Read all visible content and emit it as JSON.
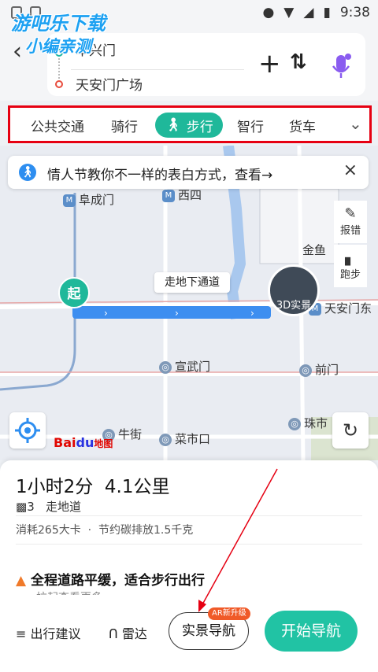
{
  "watermark": {
    "line1": "游吧乐下载",
    "line2": "小编亲测"
  },
  "status_bar": {
    "time": "9:38"
  },
  "route": {
    "start": "阜兴门",
    "end": "天安门广场"
  },
  "header_icons": {
    "back": "back-arrow-icon",
    "add": "plus-icon",
    "swap": "swap-icon",
    "mic": "microphone-icon"
  },
  "tabs": [
    "公共交通",
    "骑行",
    "步行",
    "智行",
    "货车"
  ],
  "active_tab_index": 2,
  "banner": {
    "text": "情人节教你不一样的表白方式，查看→"
  },
  "map": {
    "side_buttons": [
      {
        "label": "报错"
      },
      {
        "label": "跑步"
      }
    ],
    "labels": {
      "fuchengmen": "阜成门",
      "xisi": "西四",
      "jinyu": "金鱼",
      "tiananmen_east": "天安门东",
      "xuanwumen": "宣武门",
      "qianmen": "前门",
      "zhushikou": "珠市",
      "niujie": "牛街",
      "caishikou": "菜市口"
    },
    "start_marker": "起",
    "tunnel_callout": "走地下通道",
    "ar_bubble": "3D实景",
    "baidu_logo": {
      "bai": "Bai",
      "du": "du",
      "map": "地图"
    }
  },
  "summary": {
    "duration": "1小时2分",
    "distance": "4.1公里",
    "traffic_lights": "3",
    "tunnel": "走地道",
    "calorie": "消耗265大卡",
    "carbon": "节约碳排放1.5千克",
    "flat_note": "全程道路平缓，适合步行出行",
    "pull_more": "拉起查看更多"
  },
  "bottom_bar": {
    "advice": "出行建议",
    "radar": "雷达",
    "ar_nav": "实景导航",
    "ar_badge": "AR新升级",
    "start_nav": "开始导航"
  },
  "colors": {
    "accent": "#1fb89a",
    "highlight_box": "#e60012",
    "route_blue": "#3d8ef0",
    "start_button": "#21c3a4"
  }
}
